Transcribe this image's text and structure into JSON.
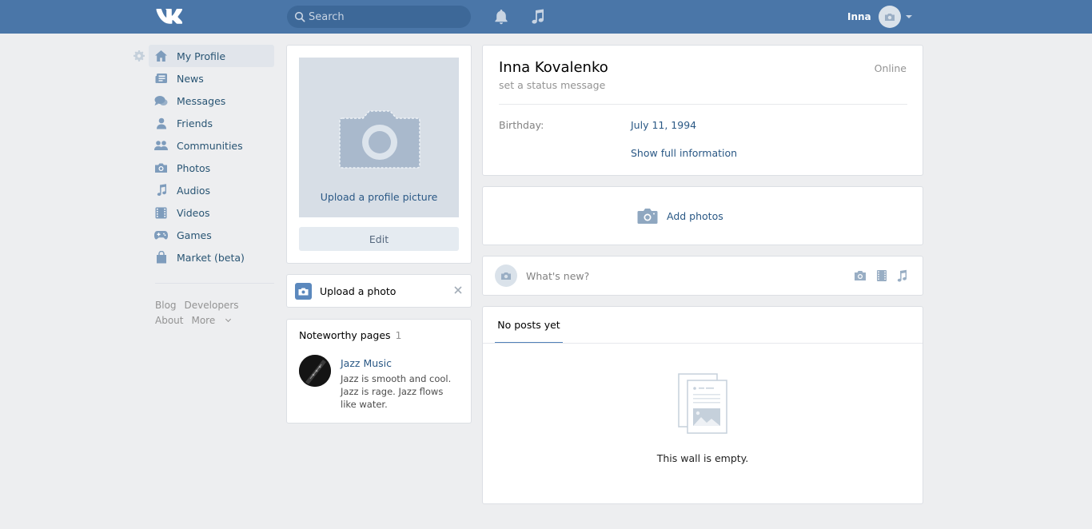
{
  "header": {
    "logo": "vk-logo",
    "search_placeholder": "Search",
    "user_name": "Inna"
  },
  "sidebar": {
    "items": [
      {
        "label": "My Profile",
        "icon": "home-icon"
      },
      {
        "label": "News",
        "icon": "news-icon"
      },
      {
        "label": "Messages",
        "icon": "messages-icon"
      },
      {
        "label": "Friends",
        "icon": "friend-icon"
      },
      {
        "label": "Communities",
        "icon": "communities-icon"
      },
      {
        "label": "Photos",
        "icon": "camera-icon"
      },
      {
        "label": "Audios",
        "icon": "music-note-icon"
      },
      {
        "label": "Videos",
        "icon": "film-icon"
      },
      {
        "label": "Games",
        "icon": "gamepad-icon"
      },
      {
        "label": "Market (beta)",
        "icon": "bag-icon"
      }
    ],
    "footer": {
      "blog": "Blog",
      "developers": "Developers",
      "about": "About",
      "more": "More"
    }
  },
  "profile_photo": {
    "upload_label": "Upload a profile picture",
    "edit_label": "Edit"
  },
  "upload_photo": {
    "label": "Upload a photo"
  },
  "noteworthy": {
    "title": "Noteworthy pages",
    "count": "1",
    "page_name": "Jazz Music",
    "page_description": "Jazz is smooth and cool. Jazz is rage. Jazz flows like water."
  },
  "profile": {
    "name": "Inna Kovalenko",
    "status": "set a status message",
    "online": "Online",
    "birthday_label": "Birthday:",
    "birthday_value": "July 11, 1994",
    "show_full": "Show full information"
  },
  "add_photos": {
    "label": "Add photos"
  },
  "composer": {
    "placeholder": "What's new?"
  },
  "wall": {
    "tab": "No posts yet",
    "empty_text": "This wall is empty."
  },
  "colors": {
    "header_bg": "#4a76a8",
    "page_bg": "#edeef0",
    "link": "#2a5885",
    "icon": "#7e9cbc"
  }
}
